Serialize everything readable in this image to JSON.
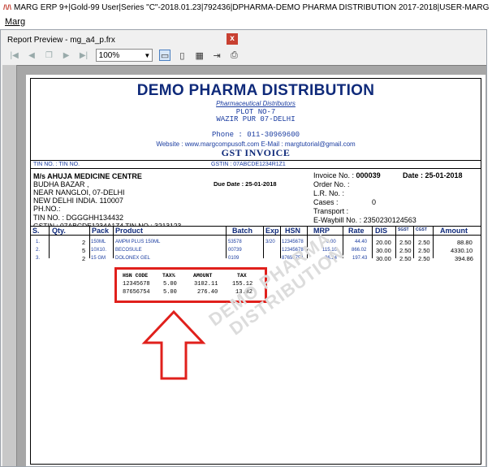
{
  "app": {
    "title": "MARG ERP 9+|Gold-99 User|Series \"C\"-2018.01.23|792436|DPHARMA-DEMO PHARMA DISTRIBUTION 2017-2018|USER-MARG",
    "menu": "Marg"
  },
  "preview": {
    "title": "Report Preview - mg_a4_p.frx",
    "close": "x",
    "zoom": "100%"
  },
  "invoice": {
    "company": "DEMO PHARMA DISTRIBUTION",
    "subtitle": "Pharmaceutical Distributors",
    "address1": "PLOT NO-7",
    "address2": "WAZIR PUR 07-DELHI",
    "phone": "Phone : 011-30969600",
    "website": "Website : www.margcompusoft.com E-Mail : margtutorial@gmail.com",
    "doc_title": "GST INVOICE",
    "tin_left": "TIN NO. : TIN NO.",
    "gstin_top": "GSTIN : 07ABCDE1234R1Z1",
    "customer": {
      "name": "M/s AHUJA MEDICINE CENTRE",
      "line1": "BUDHA BAZAR ,",
      "line2": "NEAR NANGLOI, 07-DELHI",
      "line3": "NEW DELHI INDIA. 110007",
      "phone": "PH.NO.:",
      "tin": "TIN NO. : DGGGHH134432",
      "gstin": "GSTIN : 07ABCDE1234A1Z4 TIN NO : 3213123"
    },
    "due_date": "Due Date  : 25-01-2018",
    "right": {
      "invoice_no_label": "Invoice No. :",
      "invoice_no": "000039",
      "date": "Date : 25-01-2018",
      "order_no": "Order No.  :",
      "lr_no": "L.R. No.   :",
      "cases": "Cases       :",
      "cases_val": "0",
      "transport": "Transport  :",
      "ewaybill": "E-Waybill No.  : 2350230124563"
    },
    "columns": [
      "S.",
      "Qty.",
      "Pack",
      "Product",
      "Batch",
      "Exp",
      "HSN",
      "MRP",
      "Rate",
      "DIS",
      "SGST",
      "CGST",
      "Amount"
    ],
    "rows": [
      [
        "1.",
        "2",
        "150ML",
        "AMPM PLUS 150ML",
        "53578",
        "3/20",
        "12345678",
        "0.00",
        "44.40",
        "20.00",
        "2.50",
        "2.50",
        "88.80"
      ],
      [
        "2.",
        "5",
        "10X10.",
        "BECOSULE",
        "00739",
        "",
        "12345678",
        "115.10",
        "866.02",
        "30.00",
        "2.50",
        "2.50",
        "4330.10"
      ],
      [
        "3.",
        "2",
        "15 GM",
        "DOLONEX GEL",
        "0109",
        "",
        "87656754",
        "26.24",
        "197.43",
        "30.00",
        "2.50",
        "2.50",
        "394.86"
      ]
    ],
    "tax_summary": {
      "headers": [
        "HSN CODE",
        "TAX%",
        "AMOUNT",
        "TAX"
      ],
      "rows": [
        [
          "12345678",
          "5.00",
          "3102.11",
          "155.12"
        ],
        [
          "87656754",
          "5.00",
          "276.40",
          "13.82"
        ]
      ]
    },
    "watermark_line1": "DEMO PHARMA",
    "watermark_line2": "DISTRIBUTION"
  },
  "colors": {
    "brand_blue": "#0f2a7a",
    "highlight_red": "#e0201c"
  }
}
